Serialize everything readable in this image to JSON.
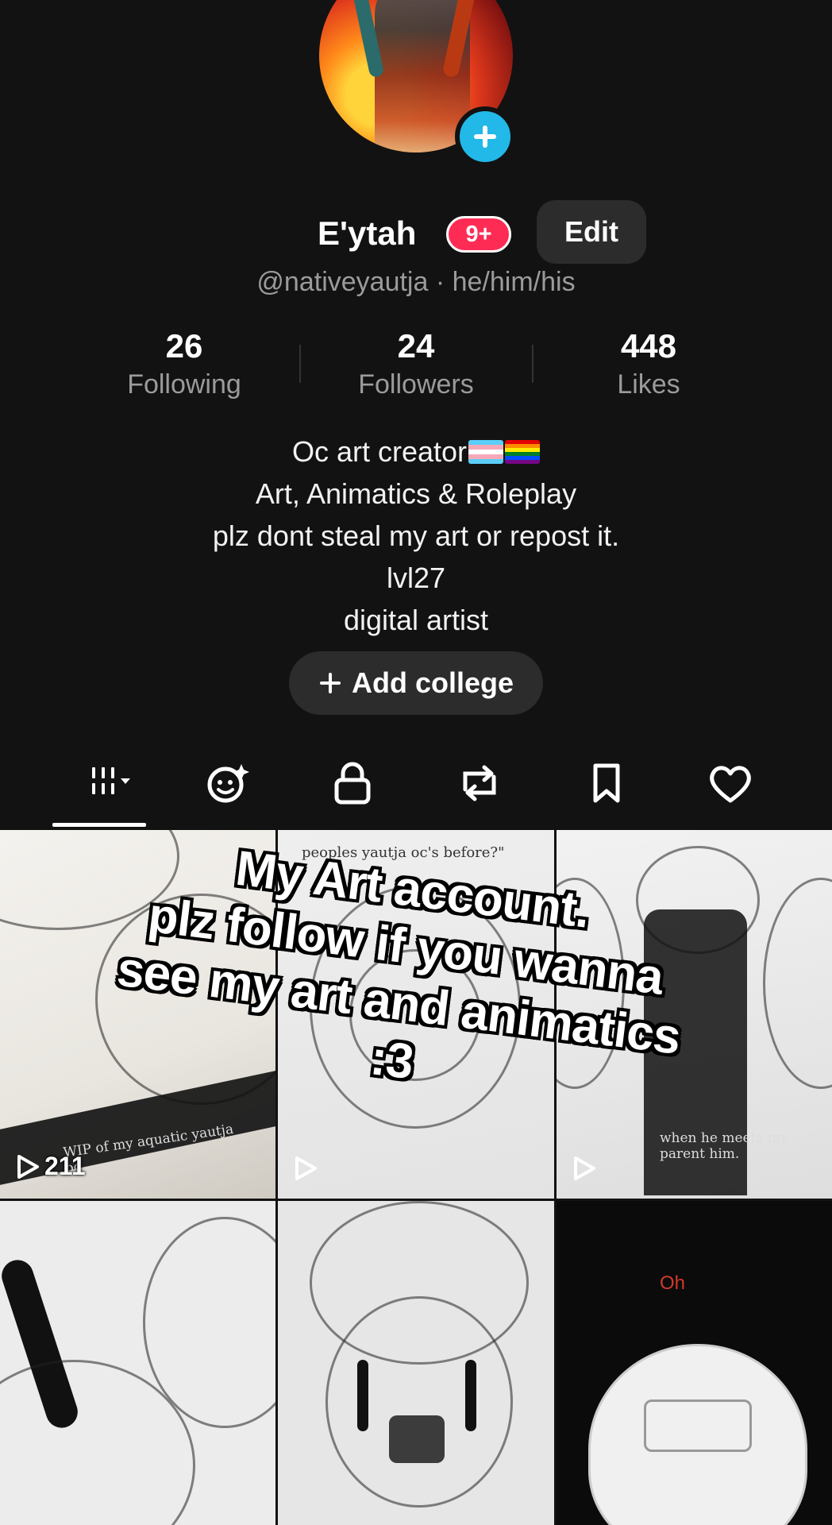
{
  "profile": {
    "name": "E'ytah",
    "notification_badge": "9+",
    "edit_label": "Edit",
    "handle_line": "@nativeyautja · he/him/his",
    "stats": [
      {
        "value": "26",
        "label": "Following"
      },
      {
        "value": "24",
        "label": "Followers"
      },
      {
        "value": "448",
        "label": "Likes"
      }
    ],
    "bio_lines": [
      "Oc art creator",
      "Art, Animatics & Roleplay",
      "plz dont steal my art or repost it.",
      "lvl27",
      "digital artist"
    ],
    "add_college_label": "Add college",
    "add_college_icon": "plus-icon"
  },
  "tabs": [
    {
      "icon": "videos-grid-icon",
      "selected": true
    },
    {
      "icon": "face-sparkle-icon",
      "selected": false
    },
    {
      "icon": "lock-icon",
      "selected": false
    },
    {
      "icon": "repost-icon",
      "selected": false
    },
    {
      "icon": "bookmark-icon",
      "selected": false
    },
    {
      "icon": "heart-icon",
      "selected": false
    }
  ],
  "videos": [
    {
      "views": "211",
      "caption": "WIP of my aquatic yautja oc."
    },
    {
      "views": "",
      "caption": "peoples yautja oc's before?\""
    },
    {
      "views": "",
      "caption": "when he meets my parent him."
    },
    {
      "views": "",
      "caption": ""
    },
    {
      "views": "",
      "caption": ""
    },
    {
      "views": "",
      "caption": "Oh"
    }
  ],
  "overlay_text": [
    "My Art account.",
    "plz follow if you wanna",
    "see my art and animatics",
    ":3"
  ],
  "colors": {
    "background": "#121212",
    "accent_red": "#fe2c55",
    "accent_blue": "#22b8e8",
    "muted_text": "#9b9b9b"
  }
}
